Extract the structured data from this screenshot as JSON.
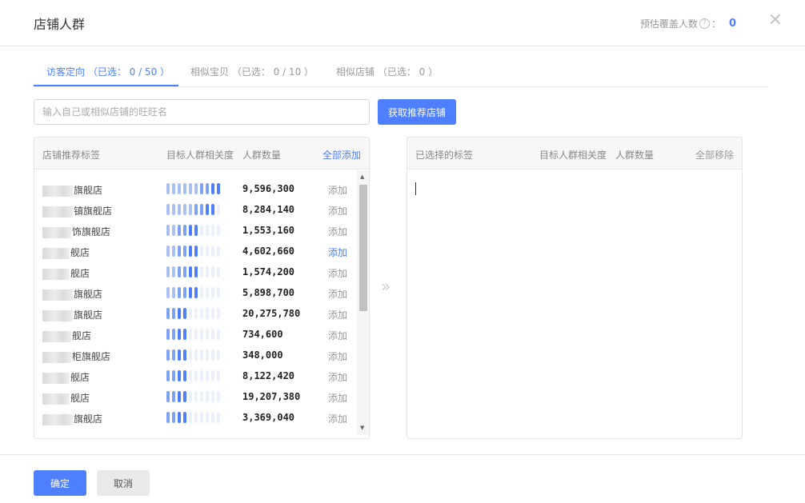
{
  "dialog": {
    "title": "店铺人群",
    "estimate_label": "预估覆盖人数",
    "estimate_colon": "：",
    "estimate_value": "0",
    "help_icon": "?",
    "close_icon": "✕"
  },
  "tabs": [
    {
      "label": "访客定向 （已选： 0 / 50 ）",
      "active": true
    },
    {
      "label": "相似宝贝 （已选： 0 / 10 ）",
      "active": false
    },
    {
      "label": "相似店铺 （已选： 0 ）",
      "active": false
    }
  ],
  "search": {
    "placeholder": "输入自己或相似店铺的旺旺名",
    "button_label": "获取推荐店铺"
  },
  "left_panel": {
    "col_tag": "店铺推荐标签",
    "col_relevance": "目标人群相关度",
    "col_count": "人群数量",
    "add_all": "全部添加",
    "rows": [
      {
        "name_suffix": "旗舰店",
        "relevance": 10,
        "count": "9,596,300",
        "add": "添加"
      },
      {
        "name_suffix": "镇旗舰店",
        "relevance": 9,
        "count": "8,284,140",
        "add": "添加"
      },
      {
        "name_suffix": "饰旗舰店",
        "relevance": 6,
        "count": "1,553,160",
        "add": "添加"
      },
      {
        "name_suffix": "舰店",
        "relevance": 6,
        "count": "4,602,660",
        "add": "添加"
      },
      {
        "name_suffix": "舰店",
        "relevance": 6,
        "count": "1,574,200",
        "add": "添加"
      },
      {
        "name_suffix": "旗舰店",
        "relevance": 6,
        "count": "5,898,700",
        "add": "添加"
      },
      {
        "name_suffix": "旗舰店",
        "relevance": 4,
        "count": "20,275,780",
        "add": "添加"
      },
      {
        "name_suffix": "舰店",
        "relevance": 4,
        "count": "734,600",
        "add": "添加"
      },
      {
        "name_suffix": "柜旗舰店",
        "relevance": 4,
        "count": "348,000",
        "add": "添加"
      },
      {
        "name_suffix": "舰店",
        "relevance": 4,
        "count": "8,122,420",
        "add": "添加"
      },
      {
        "name_suffix": "舰店",
        "relevance": 4,
        "count": "19,207,380",
        "add": "添加"
      },
      {
        "name_suffix": "旗舰店",
        "relevance": 4,
        "count": "3,369,040",
        "add": "添加"
      }
    ]
  },
  "right_panel": {
    "col_tag": "已选择的标签",
    "col_relevance": "目标人群相关度",
    "col_count": "人群数量",
    "remove_all": "全部移除"
  },
  "transfer_icon": "»",
  "footer": {
    "ok_label": "确定",
    "cancel_label": "取消"
  },
  "colors": {
    "accent": "#4d7fff",
    "relevance_on": "#a9c0f5",
    "relevance_off": "#ebf0fa"
  }
}
